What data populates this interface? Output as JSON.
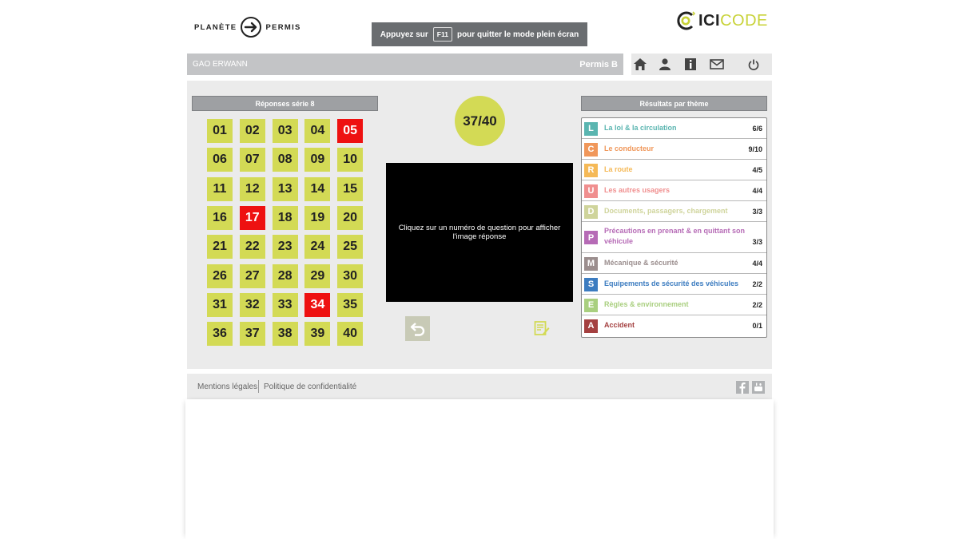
{
  "header": {
    "logo_left_part1": "PLANÈTE",
    "logo_left_part2": "PERMIS",
    "fullscreen_prefix": "Appuyez sur",
    "fullscreen_key": "F11",
    "fullscreen_suffix": "pour quitter le mode plein écran",
    "logo_right_part1": "ICI",
    "logo_right_part2": "CODE"
  },
  "user_bar": {
    "user_name": "GAO ERWANN",
    "license": "Permis B"
  },
  "nav_icons": [
    "home-icon",
    "user-icon",
    "info-icon",
    "mail-icon",
    "power-icon"
  ],
  "answers": {
    "title": "Réponses série 8",
    "cells": [
      {
        "label": "01",
        "wrong": false
      },
      {
        "label": "02",
        "wrong": false
      },
      {
        "label": "03",
        "wrong": false
      },
      {
        "label": "04",
        "wrong": false
      },
      {
        "label": "05",
        "wrong": true
      },
      {
        "label": "06",
        "wrong": false
      },
      {
        "label": "07",
        "wrong": false
      },
      {
        "label": "08",
        "wrong": false
      },
      {
        "label": "09",
        "wrong": false
      },
      {
        "label": "10",
        "wrong": false
      },
      {
        "label": "11",
        "wrong": false
      },
      {
        "label": "12",
        "wrong": false
      },
      {
        "label": "13",
        "wrong": false
      },
      {
        "label": "14",
        "wrong": false
      },
      {
        "label": "15",
        "wrong": false
      },
      {
        "label": "16",
        "wrong": false
      },
      {
        "label": "17",
        "wrong": true
      },
      {
        "label": "18",
        "wrong": false
      },
      {
        "label": "19",
        "wrong": false
      },
      {
        "label": "20",
        "wrong": false
      },
      {
        "label": "21",
        "wrong": false
      },
      {
        "label": "22",
        "wrong": false
      },
      {
        "label": "23",
        "wrong": false
      },
      {
        "label": "24",
        "wrong": false
      },
      {
        "label": "25",
        "wrong": false
      },
      {
        "label": "26",
        "wrong": false
      },
      {
        "label": "27",
        "wrong": false
      },
      {
        "label": "28",
        "wrong": false
      },
      {
        "label": "29",
        "wrong": false
      },
      {
        "label": "30",
        "wrong": false
      },
      {
        "label": "31",
        "wrong": false
      },
      {
        "label": "32",
        "wrong": false
      },
      {
        "label": "33",
        "wrong": false
      },
      {
        "label": "34",
        "wrong": true
      },
      {
        "label": "35",
        "wrong": false
      },
      {
        "label": "36",
        "wrong": false
      },
      {
        "label": "37",
        "wrong": false
      },
      {
        "label": "38",
        "wrong": false
      },
      {
        "label": "39",
        "wrong": false
      },
      {
        "label": "40",
        "wrong": false
      }
    ]
  },
  "score": {
    "text": "37/40"
  },
  "image_area": {
    "message": "Cliquez sur un numéro de question pour afficher l'image réponse"
  },
  "results": {
    "title": "Résultats par thème",
    "rows": [
      {
        "letter": "L",
        "label": "La loi & la circulation",
        "score": "6/6",
        "color": "#5ab5b0"
      },
      {
        "letter": "C",
        "label": "Le conducteur",
        "score": "9/10",
        "color": "#f0975a"
      },
      {
        "letter": "R",
        "label": "La route",
        "score": "4/5",
        "color": "#f5b957"
      },
      {
        "letter": "U",
        "label": "Les autres usagers",
        "score": "4/4",
        "color": "#f08f8f"
      },
      {
        "letter": "D",
        "label": "Documents, passagers, chargement",
        "score": "3/3",
        "color": "#cfd49b"
      },
      {
        "letter": "P",
        "label": "Précautions en prenant & en quittant son véhicule",
        "score": "3/3",
        "color": "#b66bb6"
      },
      {
        "letter": "M",
        "label": "Mécanique & sécurité",
        "score": "4/4",
        "color": "#9b8e8e"
      },
      {
        "letter": "S",
        "label": "Equipements de sécurité des véhicules",
        "score": "2/2",
        "color": "#3c7cc0"
      },
      {
        "letter": "E",
        "label": "Règles & environnement",
        "score": "2/2",
        "color": "#a9cf7f"
      },
      {
        "letter": "A",
        "label": "Accident",
        "score": "0/1",
        "color": "#a44040"
      }
    ]
  },
  "colors": {
    "accent": "#d3da55",
    "wrong": "#ee1111"
  },
  "footer": {
    "legal": "Mentions légales",
    "privacy": "Politique de confidentialité",
    "social": [
      "facebook-icon",
      "youtube-icon"
    ]
  }
}
